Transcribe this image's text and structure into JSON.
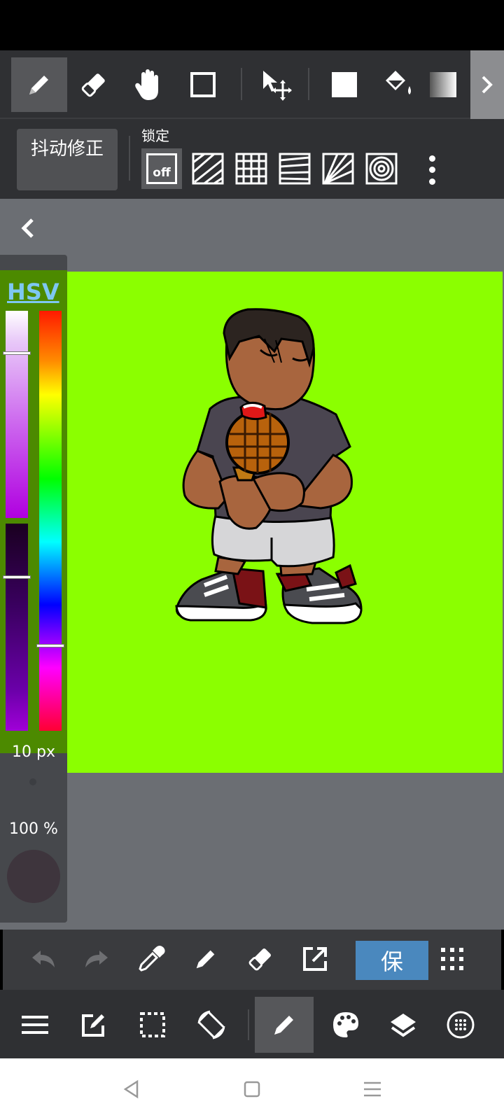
{
  "toolbar": {
    "tools": [
      "pen",
      "eraser",
      "hand",
      "shape-rectangle",
      "move-transform",
      "fill-rect",
      "bucket-fill",
      "gradient"
    ],
    "selected_tool": "pen"
  },
  "stabilizer": {
    "button_label": "抖动修正",
    "lock_label": "锁定",
    "lock_off_label": "off"
  },
  "color_panel": {
    "mode_label": "HSV",
    "brush_size": "10 px",
    "opacity": "100 %",
    "current_color": "#3e353d",
    "canvas_background": "#8bff00"
  },
  "actions": {
    "save_label": "保"
  },
  "bottom_nav": {
    "selected": "pen"
  }
}
